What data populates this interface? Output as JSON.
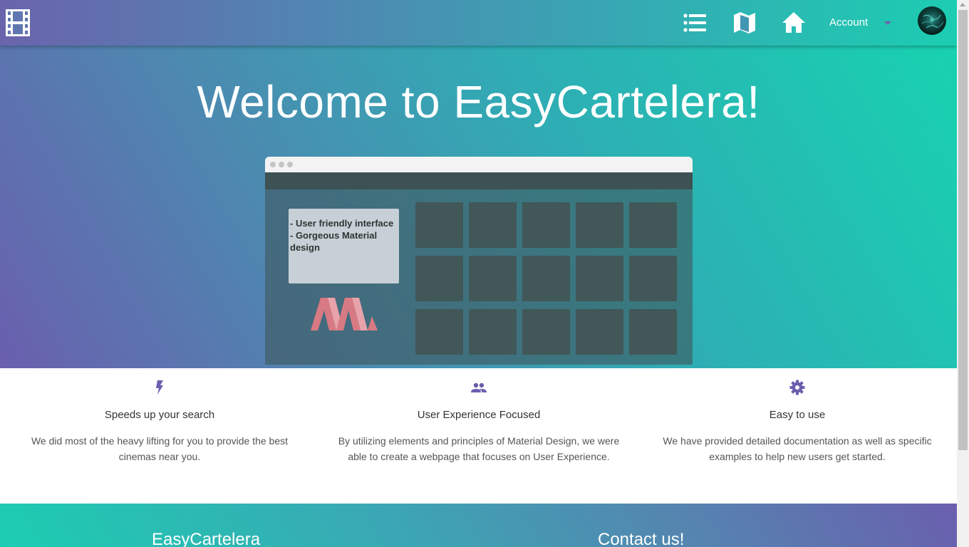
{
  "header": {
    "logo_icon": "film-strip-icon",
    "nav_icons": [
      "list-icon",
      "map-icon",
      "home-icon"
    ],
    "account_label": "Account",
    "account_caret_icon": "caret-down-icon"
  },
  "hero": {
    "title": "Welcome to EasyCartelera!",
    "mockup_card_text": "- User friendly interface\n- Gorgeous Material design"
  },
  "features": [
    {
      "icon": "bolt-icon",
      "title": "Speeds up your search",
      "text": "We did most of the heavy lifting for you to provide the best cinemas near you."
    },
    {
      "icon": "group-icon",
      "title": "User Experience Focused",
      "text": "By utilizing elements and principles of Material Design, we were able to create a webpage that focuses on User Experience."
    },
    {
      "icon": "settings-icon",
      "title": "Easy to use",
      "text": "We have provided detailed documentation as well as specific examples to help new users get started."
    }
  ],
  "footer": {
    "brand": "EasyCartelera",
    "contact_heading": "Contact us!"
  },
  "colors": {
    "accent_purple": "#6a5fae",
    "accent_teal": "#16d4b0",
    "icon_purple": "#6a5fae"
  }
}
